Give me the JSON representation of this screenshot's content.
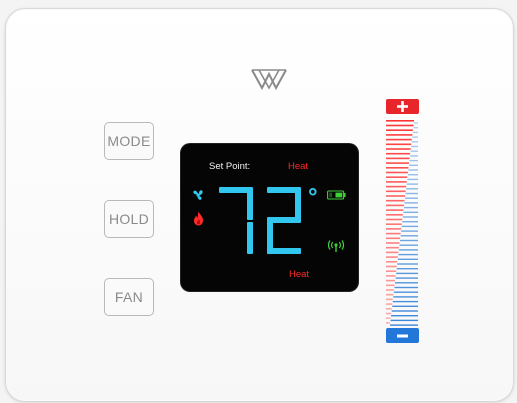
{
  "buttons": {
    "mode": "MODE",
    "hold": "HOLD",
    "fan": "FAN"
  },
  "display": {
    "set_point_label": "Set Point:",
    "set_point_mode": "Heat",
    "temperature": "72",
    "degree_symbol": "°",
    "mode_bottom": "Heat",
    "icons": [
      "fan-icon",
      "flame-icon",
      "battery-icon",
      "wireless-signal-icon"
    ]
  },
  "slider": {
    "plus_icon": "plus-icon",
    "minus_icon": "minus-icon"
  },
  "colors": {
    "digit_cyan": "#31c7ee",
    "heat_red": "#ff2a2a",
    "cool_blue": "#2f7fd8",
    "status_green": "#3ecf3a",
    "screen_bg": "#050505"
  }
}
